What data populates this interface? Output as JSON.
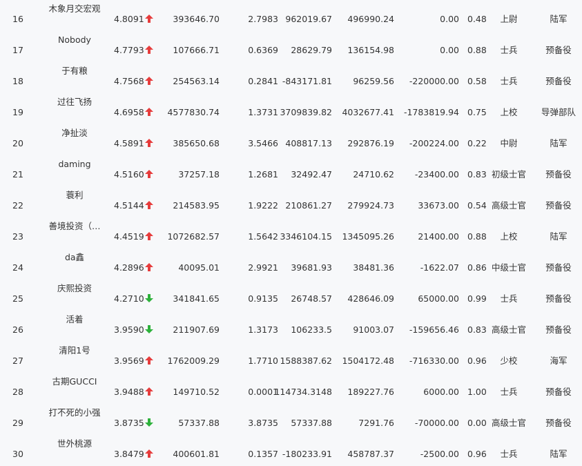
{
  "colors": {
    "up": "#e63c3c",
    "down": "#2db13b",
    "text": "#333333",
    "background": "#f7f8fa"
  },
  "rows": [
    {
      "rank": "16",
      "name": "木象月交宏观",
      "score": "4.8091",
      "trend": "up",
      "v1": "393646.70",
      "v2": "2.7983",
      "v3": "962019.67",
      "v4": "496990.24",
      "v5": "0.00",
      "v6": "0.48",
      "rank_title": "上尉",
      "unit": "陆军"
    },
    {
      "rank": "17",
      "name": "Nobody",
      "score": "4.7793",
      "trend": "up",
      "v1": "107666.71",
      "v2": "0.6369",
      "v3": "28629.79",
      "v4": "136154.98",
      "v5": "0.00",
      "v6": "0.88",
      "rank_title": "士兵",
      "unit": "预备役"
    },
    {
      "rank": "18",
      "name": "于有粮",
      "score": "4.7568",
      "trend": "up",
      "v1": "254563.14",
      "v2": "0.2841",
      "v3": "-843171.81",
      "v4": "96259.56",
      "v5": "-220000.00",
      "v6": "0.58",
      "rank_title": "士兵",
      "unit": "预备役"
    },
    {
      "rank": "19",
      "name": "过往飞扬",
      "score": "4.6958",
      "trend": "up",
      "v1": "4577830.74",
      "v2": "1.3731",
      "v3": "3709839.82",
      "v4": "4032677.41",
      "v5": "-1783819.94",
      "v6": "0.75",
      "rank_title": "上校",
      "unit": "导弹部队"
    },
    {
      "rank": "20",
      "name": "净扯淡",
      "score": "4.5891",
      "trend": "up",
      "v1": "385650.68",
      "v2": "3.5466",
      "v3": "408817.13",
      "v4": "292876.19",
      "v5": "-200224.00",
      "v6": "0.22",
      "rank_title": "中尉",
      "unit": "陆军"
    },
    {
      "rank": "21",
      "name": "daming",
      "score": "4.5160",
      "trend": "up",
      "v1": "37257.18",
      "v2": "1.2681",
      "v3": "32492.47",
      "v4": "24710.62",
      "v5": "-23400.00",
      "v6": "0.83",
      "rank_title": "初级士官",
      "unit": "预备役"
    },
    {
      "rank": "22",
      "name": "蓑利",
      "score": "4.5144",
      "trend": "up",
      "v1": "214583.95",
      "v2": "1.9222",
      "v3": "210861.27",
      "v4": "279924.73",
      "v5": "33673.00",
      "v6": "0.54",
      "rank_title": "高级士官",
      "unit": "预备役"
    },
    {
      "rank": "23",
      "name": "善境投资（…",
      "score": "4.4519",
      "trend": "up",
      "v1": "1072682.57",
      "v2": "1.5642",
      "v3": "3346104.15",
      "v4": "1345095.26",
      "v5": "21400.00",
      "v6": "0.88",
      "rank_title": "上校",
      "unit": "陆军"
    },
    {
      "rank": "24",
      "name": "da鑫",
      "score": "4.2896",
      "trend": "up",
      "v1": "40095.01",
      "v2": "2.9921",
      "v3": "39681.93",
      "v4": "38481.36",
      "v5": "-1622.07",
      "v6": "0.86",
      "rank_title": "中级士官",
      "unit": "预备役"
    },
    {
      "rank": "25",
      "name": "庆熙投资",
      "score": "4.2710",
      "trend": "down",
      "v1": "341841.65",
      "v2": "0.9135",
      "v3": "26748.57",
      "v4": "428646.09",
      "v5": "65000.00",
      "v6": "0.99",
      "rank_title": "士兵",
      "unit": "预备役"
    },
    {
      "rank": "26",
      "name": "活着",
      "score": "3.9590",
      "trend": "down",
      "v1": "211907.69",
      "v2": "1.3173",
      "v3": "106233.5",
      "v4": "91003.07",
      "v5": "-159656.46",
      "v6": "0.83",
      "rank_title": "高级士官",
      "unit": "预备役"
    },
    {
      "rank": "27",
      "name": "清阳1号",
      "score": "3.9569",
      "trend": "up",
      "v1": "1762009.29",
      "v2": "1.7710",
      "v3": "1588387.62",
      "v4": "1504172.48",
      "v5": "-716330.00",
      "v6": "0.96",
      "rank_title": "少校",
      "unit": "海军"
    },
    {
      "rank": "28",
      "name": "古期GUCCI",
      "score": "3.9488",
      "trend": "up",
      "v1": "149710.52",
      "v2": "0.0001",
      "v3": "114734.3148",
      "v4": "189227.76",
      "v5": "6000.00",
      "v6": "1.00",
      "rank_title": "士兵",
      "unit": "预备役"
    },
    {
      "rank": "29",
      "name": "打不死的小强",
      "score": "3.8735",
      "trend": "down",
      "v1": "57337.88",
      "v2": "3.8735",
      "v3": "57337.88",
      "v4": "7291.76",
      "v5": "-70000.00",
      "v6": "0.00",
      "rank_title": "高级士官",
      "unit": "预备役"
    },
    {
      "rank": "30",
      "name": "世外桃源",
      "score": "3.8479",
      "trend": "up",
      "v1": "400601.81",
      "v2": "0.1357",
      "v3": "-180233.91",
      "v4": "458787.37",
      "v5": "-2500.00",
      "v6": "0.96",
      "rank_title": "士兵",
      "unit": "陆军"
    }
  ]
}
